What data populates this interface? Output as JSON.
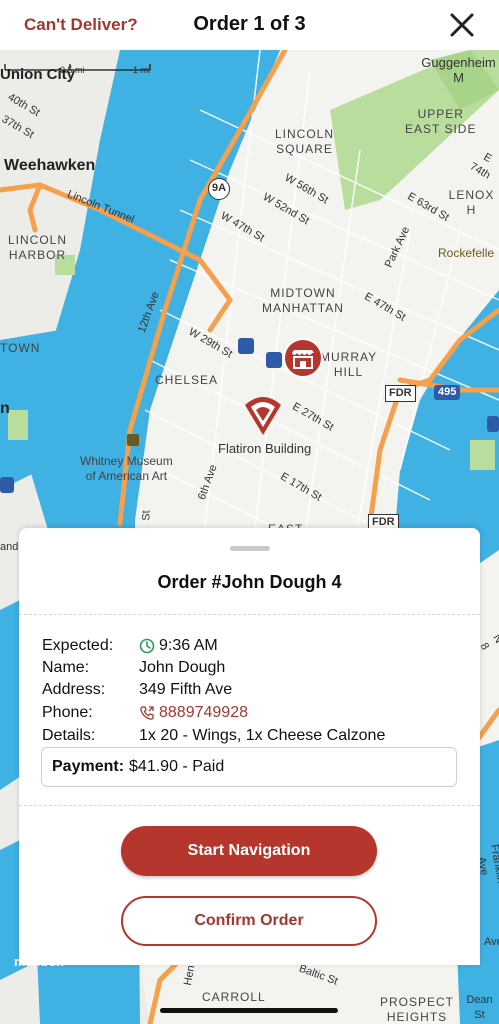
{
  "header": {
    "cant_deliver": "Can't Deliver?",
    "order_count": "Order 1 of 3",
    "close_icon": "close-icon"
  },
  "map": {
    "scale_left": "0.5 mi",
    "scale_right": "1 mi",
    "labels": {
      "union_city": "Union City",
      "guggenheim": "Guggenheim M",
      "w40th": "40th St",
      "w37th": "37th St",
      "weehawken": "Weehawken",
      "upper_east_side": "UPPER\nEAST SIDE",
      "lincoln_square": "LINCOLN\nSQUARE",
      "e74th": "E 74th",
      "lincoln_tunnel": "Lincoln Tunnel",
      "route_9a": "9A",
      "w56th": "W 56th St",
      "w52nd": "W 52nd St",
      "w47th": "W 47th St",
      "lenox_hill": "LENOX H",
      "e63rd": "E 63rd St",
      "lincoln_harbor": "LINCOLN\nHARBOR",
      "park_ave": "Park Ave",
      "rockefeller": "Rockefelle",
      "twelfth_ave": "12th Ave",
      "midtown": "MIDTOWN\nMANHATTAN",
      "e47th": "E 47th St",
      "town": "TOWN",
      "w29th": "W 29th St",
      "murray_hill": "MURRAY\nHILL",
      "chelsea": "CHELSEA",
      "fdr": "FDR",
      "route_495": "495",
      "e27th": "E 27th St",
      "flatiron": "Flatiron Building",
      "whitney": "Whitney Museum\nof American Art",
      "sixth_ave": "6th Ave",
      "e17th": "E 17th St",
      "fdr2": "FDR",
      "east": "EAST",
      "n_label": "n",
      "and_label": "and",
      "n8": "N 8",
      "brooklyn_label": "Franklin Ave",
      "ave_label": "Ave",
      "hen_label": "Hen",
      "baltic": "Baltic St",
      "st_label": "St",
      "carroll": "CARROLL",
      "dean": "Dean St",
      "prospect": "PROSPECT\nHEIGHTS",
      "mapbox": "mapbox"
    }
  },
  "order": {
    "title": "Order #John Dough 4",
    "expected_label": "Expected:",
    "expected_value": "9:36 AM",
    "name_label": "Name:",
    "name_value": "John Dough",
    "address_label": "Address:",
    "address_value": "349 Fifth Ave",
    "phone_label": "Phone:",
    "phone_value": "8889749928",
    "details_label": "Details:",
    "details_value": "1x 20 - Wings, 1x Cheese Calzone",
    "payment_label": "Payment:",
    "payment_value": "$41.90 - Paid"
  },
  "buttons": {
    "start_navigation": "Start Navigation",
    "confirm_order": "Confirm Order"
  },
  "colors": {
    "brand": "#b5362c",
    "water": "#3fb1e3",
    "park": "#b9dd9c",
    "highway": "#f5a04c"
  }
}
